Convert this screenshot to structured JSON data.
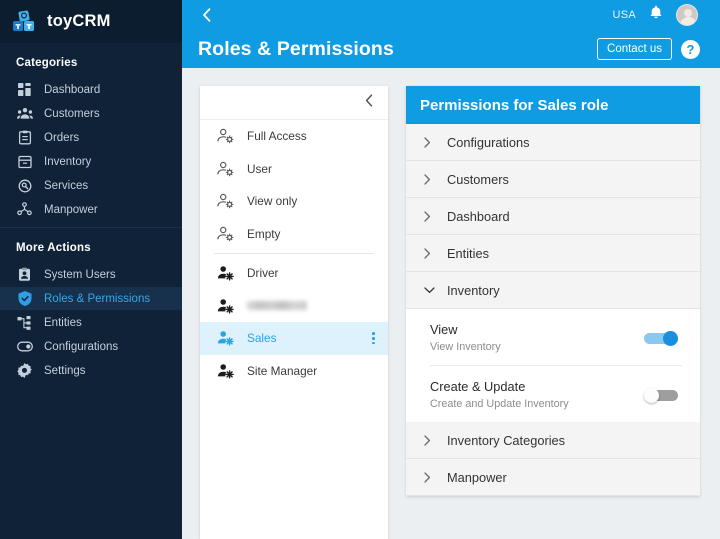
{
  "app": {
    "name": "toyCRM",
    "logo_icon": "toy-blocks-logo-icon"
  },
  "sidebar": {
    "sections": [
      {
        "label": "Categories",
        "items": [
          {
            "label": "Dashboard",
            "icon": "dashboard-icon",
            "active": false
          },
          {
            "label": "Customers",
            "icon": "customers-icon",
            "active": false
          },
          {
            "label": "Orders",
            "icon": "orders-icon",
            "active": false
          },
          {
            "label": "Inventory",
            "icon": "inventory-icon",
            "active": false
          },
          {
            "label": "Services",
            "icon": "services-icon",
            "active": false
          },
          {
            "label": "Manpower",
            "icon": "manpower-icon",
            "active": false
          }
        ]
      },
      {
        "label": "More Actions",
        "items": [
          {
            "label": "System Users",
            "icon": "system-users-icon",
            "active": false
          },
          {
            "label": "Roles & Permissions",
            "icon": "shield-check-icon",
            "active": true
          },
          {
            "label": "Entities",
            "icon": "entities-icon",
            "active": false
          },
          {
            "label": "Configurations",
            "icon": "configurations-icon",
            "active": false
          },
          {
            "label": "Settings",
            "icon": "gear-icon",
            "active": false
          }
        ]
      }
    ]
  },
  "topbar": {
    "back_icon": "chevron-left-icon",
    "title": "Roles & Permissions",
    "region": "USA",
    "bell_icon": "notification-bell-icon",
    "avatar_icon": "user-avatar",
    "contact_label": "Contact us",
    "help_label": "?",
    "accent_color": "#0f9ce3"
  },
  "roles_panel": {
    "collapse_icon": "chevron-left-icon",
    "roles": [
      {
        "label": "Full Access",
        "icon": "manage-accounts-outline-icon",
        "selected": false,
        "redacted": false
      },
      {
        "label": "User",
        "icon": "manage-accounts-outline-icon",
        "selected": false,
        "redacted": false
      },
      {
        "label": "View only",
        "icon": "manage-accounts-outline-icon",
        "selected": false,
        "redacted": false
      },
      {
        "label": "Empty",
        "icon": "manage-accounts-outline-icon",
        "selected": false,
        "redacted": false
      },
      {
        "label": "Driver",
        "icon": "manage-accounts-filled-icon",
        "selected": false,
        "redacted": false
      },
      {
        "label": "",
        "icon": "manage-accounts-filled-icon",
        "selected": false,
        "redacted": true
      },
      {
        "label": "Sales",
        "icon": "manage-accounts-filled-icon",
        "selected": true,
        "redacted": false
      },
      {
        "label": "Site Manager",
        "icon": "manage-accounts-filled-icon",
        "selected": false,
        "redacted": false
      }
    ],
    "kebab_icon": "more-vertical-icon"
  },
  "permissions": {
    "header": "Permissions for Sales role",
    "groups": [
      {
        "label": "Configurations",
        "expanded": false,
        "icon": "chevron-right-icon",
        "items": []
      },
      {
        "label": "Customers",
        "expanded": false,
        "icon": "chevron-right-icon",
        "items": []
      },
      {
        "label": "Dashboard",
        "expanded": false,
        "icon": "chevron-right-icon",
        "items": []
      },
      {
        "label": "Entities",
        "expanded": false,
        "icon": "chevron-right-icon",
        "items": []
      },
      {
        "label": "Inventory",
        "expanded": true,
        "icon": "chevron-down-icon",
        "items": [
          {
            "name": "View",
            "desc": "View Inventory",
            "enabled": true
          },
          {
            "name": "Create & Update",
            "desc": "Create and Update Inventory",
            "enabled": false
          }
        ]
      },
      {
        "label": "Inventory Categories",
        "expanded": false,
        "icon": "chevron-right-icon",
        "items": []
      },
      {
        "label": "Manpower",
        "expanded": false,
        "icon": "chevron-right-icon",
        "items": []
      }
    ]
  }
}
